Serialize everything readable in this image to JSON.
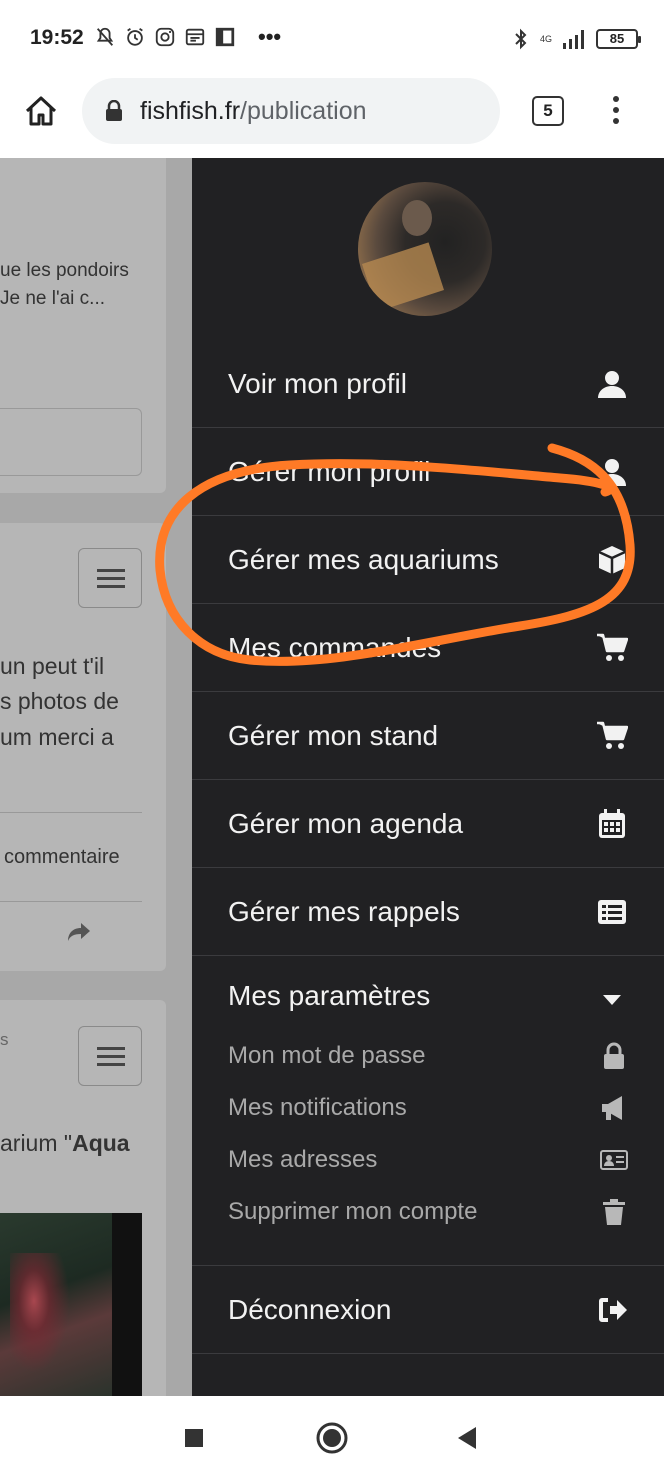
{
  "status_bar": {
    "time": "19:52",
    "network_label": "4G",
    "battery": "85",
    "more": "•••"
  },
  "browser": {
    "url_domain": "fishfish.fr",
    "url_path": "/publication",
    "tab_count": "5"
  },
  "background_page": {
    "snippet1_line1": "ue les pondoirs",
    "snippet1_line2": "Je ne l'ai c...",
    "snippet2_line1": "un peut t'il",
    "snippet2_line2": "s photos de",
    "snippet2_line3": "um merci a",
    "comment_link": "commentaire",
    "card3_meta": "s",
    "card3_title_prefix": "arium \"",
    "card3_title_bold": "Aqua"
  },
  "drawer": {
    "menu_items": [
      {
        "label": "Voir mon profil",
        "icon": "user-icon"
      },
      {
        "label": "Gérer mon profil",
        "icon": "user-icon"
      },
      {
        "label": "Gérer mes aquariums",
        "icon": "cube-icon"
      },
      {
        "label": "Mes commandes",
        "icon": "cart-icon"
      },
      {
        "label": "Gérer mon stand",
        "icon": "cart-icon"
      },
      {
        "label": "Gérer mon agenda",
        "icon": "calendar-icon"
      },
      {
        "label": "Gérer mes rappels",
        "icon": "list-icon"
      }
    ],
    "settings": {
      "label": "Mes paramètres",
      "icon": "caret-down-icon",
      "items": [
        {
          "label": "Mon mot de passe",
          "icon": "lock-icon"
        },
        {
          "label": "Mes notifications",
          "icon": "megaphone-icon"
        },
        {
          "label": "Mes adresses",
          "icon": "address-card-icon"
        },
        {
          "label": "Supprimer mon compte",
          "icon": "trash-icon"
        }
      ]
    },
    "logout": {
      "label": "Déconnexion",
      "icon": "sign-out-icon"
    }
  },
  "colors": {
    "drawer_bg": "#212123",
    "annotation": "#ff7a26",
    "overlay_bg": "#a8a8a8"
  }
}
